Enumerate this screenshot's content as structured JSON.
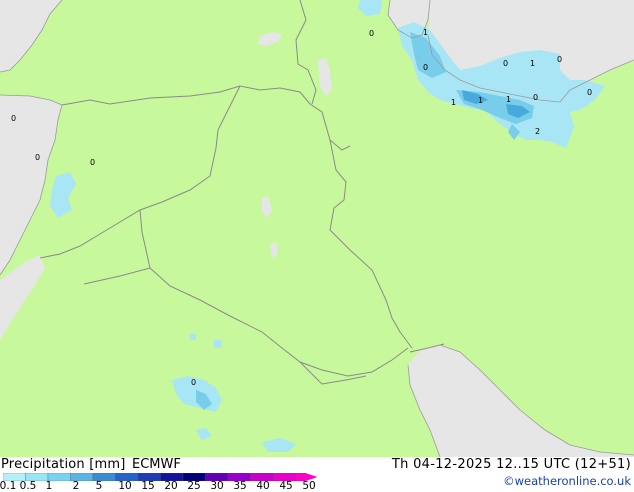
{
  "title": "Precipitation [mm]",
  "model": "ECMWF",
  "valid_time": "Th 04-12-2025 12..15 UTC (12+51)",
  "credit": "©weatheronline.co.uk",
  "colors": {
    "land": "#c7f89b",
    "sea": "#e6e6e6",
    "border": "#8a8a8a",
    "precip_light": "#a8e6f5",
    "precip_mid": "#78cdea",
    "precip_heavy": "#48a9dd"
  },
  "legend": {
    "ticks": [
      "0.1",
      "0.5",
      "1",
      "2",
      "5",
      "10",
      "15",
      "20",
      "25",
      "30",
      "35",
      "40",
      "45",
      "50"
    ],
    "colors": [
      "#b4f0fa",
      "#96e6f5",
      "#78d2f0",
      "#5ab4e6",
      "#3c8cd2",
      "#2864c8",
      "#1e3cb4",
      "#14149b",
      "#000078",
      "#6400b4",
      "#9600c8",
      "#c800c8",
      "#e600c8",
      "#ff00c8"
    ]
  },
  "map_labels": [
    {
      "text": "0"
    },
    {
      "text": "1"
    },
    {
      "text": "0"
    },
    {
      "text": "0"
    },
    {
      "text": "1"
    },
    {
      "text": "0"
    },
    {
      "text": "1"
    },
    {
      "text": "1"
    },
    {
      "text": "1"
    },
    {
      "text": "0"
    },
    {
      "text": "0"
    },
    {
      "text": "2"
    },
    {
      "text": "0"
    },
    {
      "text": "0"
    },
    {
      "text": "0"
    },
    {
      "text": "0"
    }
  ]
}
